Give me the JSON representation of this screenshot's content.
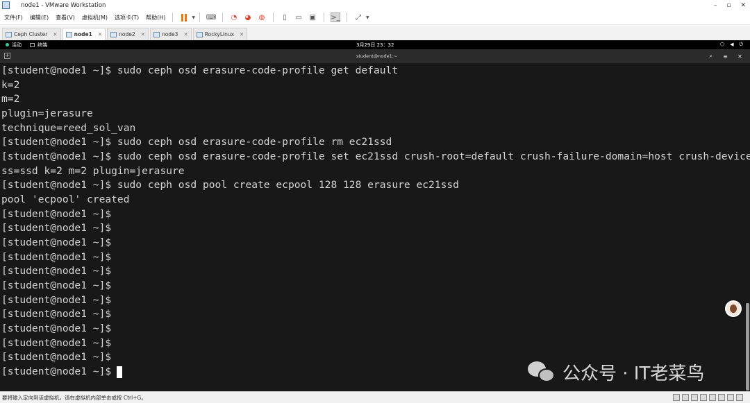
{
  "window": {
    "title": "node1 - VMware Workstation",
    "controls": [
      "–",
      "▫",
      "✕"
    ]
  },
  "menu": [
    "文件(F)",
    "编辑(E)",
    "查看(V)",
    "虚拟机(M)",
    "选项卡(T)",
    "帮助(H)"
  ],
  "toolbar": {
    "icons": [
      "pause-icon",
      "send-keys-icon",
      "snapshot-icon",
      "revert-snapshot-icon",
      "snapshot-manager-icon",
      "library-view-icon",
      "single-window-icon",
      "thumbnail-view-icon",
      "console-view-icon",
      "fullscreen-icon"
    ]
  },
  "tabs": [
    {
      "label": "Ceph Cluster",
      "active": false
    },
    {
      "label": "node1",
      "active": true
    },
    {
      "label": "node2",
      "active": false
    },
    {
      "label": "node3",
      "active": false
    },
    {
      "label": "RockyLinux",
      "active": false
    }
  ],
  "gnome": {
    "activities": "活动",
    "app": "终端",
    "clock": "3月29日 23：32"
  },
  "terminal": {
    "title": "student@node1:~",
    "lines": [
      "[student@node1 ~]$ sudo ceph osd erasure-code-profile get default",
      "k=2",
      "m=2",
      "plugin=jerasure",
      "technique=reed_sol_van",
      "[student@node1 ~]$ sudo ceph osd erasure-code-profile rm ec21ssd",
      "[student@node1 ~]$ sudo ceph osd erasure-code-profile set ec21ssd crush-root=default crush-failure-domain=host crush-device-cla",
      "ss=ssd k=2 m=2 plugin=jerasure",
      "[student@node1 ~]$ sudo ceph osd pool create ecpool 128 128 erasure ec21ssd",
      "pool 'ecpool' created",
      "[student@node1 ~]$",
      "[student@node1 ~]$",
      "[student@node1 ~]$",
      "[student@node1 ~]$",
      "[student@node1 ~]$",
      "[student@node1 ~]$",
      "[student@node1 ~]$",
      "[student@node1 ~]$",
      "[student@node1 ~]$",
      "[student@node1 ~]$",
      "[student@node1 ~]$",
      "[student@node1 ~]$"
    ]
  },
  "watermark": "公众号 · IT老菜鸟",
  "statusbar": {
    "text": "要将输入定向到该虚拟机，请在虚拟机内部单击或按 Ctrl+G。"
  }
}
